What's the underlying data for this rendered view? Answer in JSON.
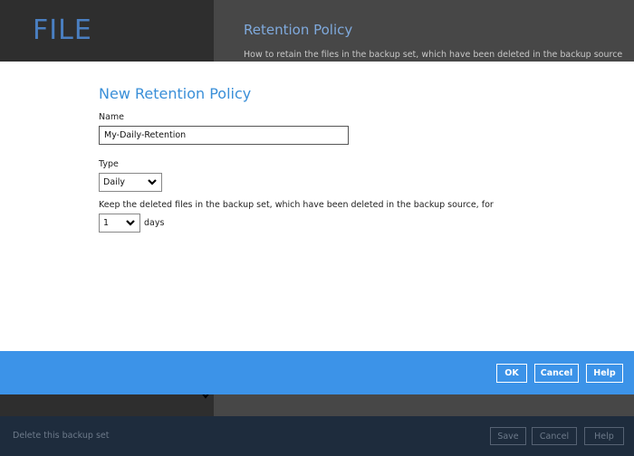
{
  "background": {
    "app_title": "FILE",
    "section_heading": "Retention Policy",
    "section_description": "How to retain the files in the backup set, which have been deleted in the backup source",
    "cut_off_text": "——————",
    "delete_link": "Delete this backup set",
    "buttons": {
      "save": "Save",
      "cancel": "Cancel",
      "help": "Help"
    }
  },
  "dialog": {
    "title": "New Retention Policy",
    "name_label": "Name",
    "name_value": "My-Daily-Retention",
    "type_label": "Type",
    "type_value": "Daily",
    "keep_label": "Keep the deleted files in the backup set, which have been deleted in the backup source, for",
    "days_value": "1",
    "days_unit": "days"
  },
  "footer": {
    "ok": "OK",
    "cancel": "Cancel",
    "help": "Help"
  },
  "colors": {
    "accent": "#3c93e8",
    "title_blue": "#3a8fd8",
    "dark_bottom": "#1e2c3d"
  }
}
